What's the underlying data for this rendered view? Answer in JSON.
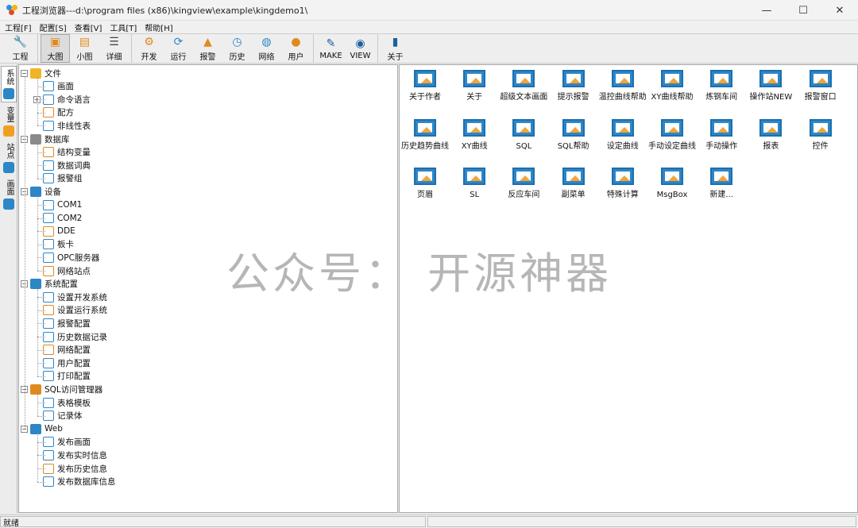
{
  "window": {
    "title": "工程浏览器---d:\\program files (x86)\\kingview\\example\\kingdemo1\\",
    "controls": [
      "—",
      "☐",
      "✕"
    ]
  },
  "menu": [
    "工程[F]",
    "配置[S]",
    "查看[V]",
    "工具[T]",
    "帮助[H]"
  ],
  "toolbar": {
    "groups": [
      [
        {
          "label": "工程",
          "icon": "wrench-icon"
        }
      ],
      [
        {
          "label": "大图",
          "icon": "large-icon-view-icon",
          "active": true
        },
        {
          "label": "小图",
          "icon": "small-icon-view-icon"
        },
        {
          "label": "详细",
          "icon": "detail-view-icon"
        }
      ],
      [
        {
          "label": "开发",
          "icon": "gear-develop-icon"
        },
        {
          "label": "运行",
          "icon": "run-icon"
        },
        {
          "label": "报警",
          "icon": "alarm-bell-icon"
        },
        {
          "label": "历史",
          "icon": "history-clock-icon"
        },
        {
          "label": "网络",
          "icon": "globe-icon"
        },
        {
          "label": "用户",
          "icon": "user-icon"
        }
      ],
      [
        {
          "label": "MAKE",
          "icon": "make-edit-icon"
        },
        {
          "label": "VIEW",
          "icon": "view-eye-icon"
        }
      ],
      [
        {
          "label": "关于",
          "icon": "about-book-icon"
        }
      ]
    ]
  },
  "side_tabs": [
    {
      "label": "系统",
      "icon": "gear-icon",
      "active": true
    },
    {
      "label": "变量",
      "icon": "cube-icon"
    },
    {
      "label": "站点",
      "icon": "station-icon"
    },
    {
      "label": "画面",
      "icon": "picture-icon"
    }
  ],
  "tree": [
    {
      "label": "文件",
      "level": 0,
      "expander": "−",
      "icon": "folder-icon"
    },
    {
      "label": "画面",
      "level": 1,
      "icon": "picture-icon"
    },
    {
      "label": "命令语言",
      "level": 1,
      "expander": "+",
      "icon": "command-icon"
    },
    {
      "label": "配方",
      "level": 1,
      "icon": "recipe-icon"
    },
    {
      "label": "非线性表",
      "level": 1,
      "icon": "nonlinear-table-icon"
    },
    {
      "label": "数据库",
      "level": 0,
      "expander": "−",
      "icon": "database-icon"
    },
    {
      "label": "结构变量",
      "level": 1,
      "icon": "structure-variable-icon"
    },
    {
      "label": "数据词典",
      "level": 1,
      "icon": "data-dictionary-icon"
    },
    {
      "label": "报警组",
      "level": 1,
      "icon": "alarm-group-icon"
    },
    {
      "label": "设备",
      "level": 0,
      "expander": "−",
      "icon": "monitor-icon"
    },
    {
      "label": "COM1",
      "level": 1,
      "icon": "com-port-icon"
    },
    {
      "label": "COM2",
      "level": 1,
      "icon": "com-port-icon"
    },
    {
      "label": "DDE",
      "level": 1,
      "icon": "dde-icon"
    },
    {
      "label": "板卡",
      "level": 1,
      "icon": "board-card-icon"
    },
    {
      "label": "OPC服务器",
      "level": 1,
      "icon": "opc-server-icon"
    },
    {
      "label": "网络站点",
      "level": 1,
      "icon": "network-station-icon"
    },
    {
      "label": "系统配置",
      "level": 0,
      "expander": "−",
      "icon": "system-config-icon"
    },
    {
      "label": "设置开发系统",
      "level": 1,
      "icon": "gear-develop-icon"
    },
    {
      "label": "设置运行系统",
      "level": 1,
      "icon": "run-icon"
    },
    {
      "label": "报警配置",
      "level": 1,
      "icon": "alarm-bell-icon"
    },
    {
      "label": "历史数据记录",
      "level": 1,
      "icon": "history-clock-icon"
    },
    {
      "label": "网络配置",
      "level": 1,
      "icon": "globe-icon"
    },
    {
      "label": "用户配置",
      "level": 1,
      "icon": "user-icon"
    },
    {
      "label": "打印配置",
      "level": 1,
      "icon": "printer-icon"
    },
    {
      "label": "SQL访问管理器",
      "level": 0,
      "expander": "−",
      "icon": "sql-manager-icon"
    },
    {
      "label": "表格模板",
      "level": 1,
      "icon": "table-template-icon"
    },
    {
      "label": "记录体",
      "level": 1,
      "icon": "record-icon"
    },
    {
      "label": "Web",
      "level": 0,
      "expander": "−",
      "icon": "web-icon"
    },
    {
      "label": "发布画面",
      "level": 1,
      "icon": "publish-picture-icon"
    },
    {
      "label": "发布实时信息",
      "level": 1,
      "icon": "publish-realtime-icon"
    },
    {
      "label": "发布历史信息",
      "level": 1,
      "icon": "publish-history-icon"
    },
    {
      "label": "发布数据库信息",
      "level": 1,
      "icon": "publish-database-icon"
    }
  ],
  "pictures": [
    "关于作者",
    "关于",
    "超级文本画面",
    "提示报警",
    "温控曲线帮助",
    "XY曲线帮助",
    "炼钢车间",
    "操作站NEW",
    "报警窗口",
    "历史趋势曲线",
    "XY曲线",
    "SQL",
    "SQL帮助",
    "设定曲线",
    "手动设定曲线",
    "手动操作",
    "报表",
    "控件",
    "页眉",
    "SL",
    "反应车间",
    "副菜单",
    "特殊计算",
    "MsgBox",
    "新建..."
  ],
  "watermark": "公众号：  开源神器",
  "status": {
    "text": "就绪"
  },
  "colors": {
    "accent_blue": "#2d86c6",
    "orange": "#f2a43a",
    "tree_line": "#9a9a9a"
  }
}
